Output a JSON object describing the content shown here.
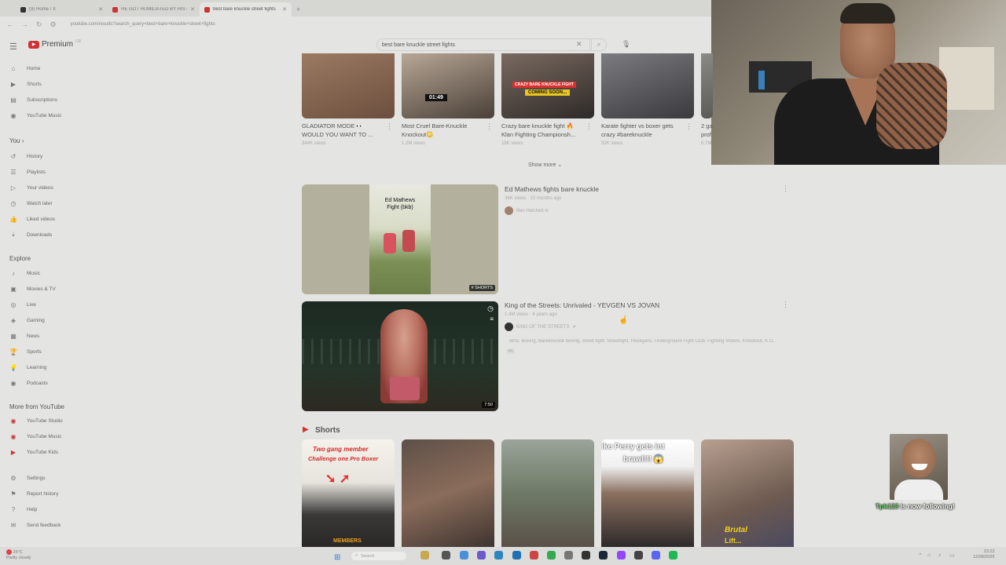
{
  "browser": {
    "tabs": [
      {
        "title": "(9) Home / X",
        "favicon": "x-icon",
        "active": false
      },
      {
        "title": "HE GOT HUMILIATED BY HIS G...",
        "favicon": "youtube-icon",
        "active": false
      },
      {
        "title": "best bare knuckle street fights",
        "favicon": "youtube-icon",
        "active": true
      }
    ],
    "new_tab": "+",
    "url": "youtube.com/results?search_query=best+bare+knuckle+street+fights"
  },
  "header": {
    "logo_text": "Premium",
    "logo_country": "GB",
    "search_value": "best bare knuckle street fights"
  },
  "sidebar": {
    "main": [
      {
        "label": "Home",
        "icon": "home-icon"
      },
      {
        "label": "Shorts",
        "icon": "shorts-icon"
      },
      {
        "label": "Subscriptions",
        "icon": "subscriptions-icon"
      },
      {
        "label": "YouTube Music",
        "icon": "music-icon"
      }
    ],
    "you_heading": "You",
    "you": [
      {
        "label": "History",
        "icon": "history-icon"
      },
      {
        "label": "Playlists",
        "icon": "playlist-icon"
      },
      {
        "label": "Your videos",
        "icon": "your-videos-icon"
      },
      {
        "label": "Watch later",
        "icon": "watch-later-icon"
      },
      {
        "label": "Liked videos",
        "icon": "like-icon"
      },
      {
        "label": "Downloads",
        "icon": "download-icon"
      }
    ],
    "explore_heading": "Explore",
    "explore": [
      {
        "label": "Music",
        "icon": "music-note-icon"
      },
      {
        "label": "Movies & TV",
        "icon": "movies-icon"
      },
      {
        "label": "Live",
        "icon": "live-icon"
      },
      {
        "label": "Gaming",
        "icon": "gaming-icon"
      },
      {
        "label": "News",
        "icon": "news-icon"
      },
      {
        "label": "Sports",
        "icon": "sports-icon"
      },
      {
        "label": "Learning",
        "icon": "learning-icon"
      },
      {
        "label": "Podcasts",
        "icon": "podcast-icon"
      }
    ],
    "more_heading": "More from YouTube",
    "more": [
      {
        "label": "YouTube Studio",
        "icon": "studio-icon"
      },
      {
        "label": "YouTube Music",
        "icon": "yt-music-icon"
      },
      {
        "label": "YouTube Kids",
        "icon": "yt-kids-icon"
      }
    ],
    "footer": [
      {
        "label": "Settings",
        "icon": "settings-icon"
      },
      {
        "label": "Report history",
        "icon": "flag-icon"
      },
      {
        "label": "Help",
        "icon": "help-icon"
      },
      {
        "label": "Send feedback",
        "icon": "feedback-icon"
      }
    ]
  },
  "top_row": [
    {
      "title_line1": "GLADIATOR MODE 👀",
      "title_line2": "WOULD YOU WANT TO ...",
      "views": "344K views"
    },
    {
      "title_line1": "Most Cruel Bare-Knuckle",
      "title_line2": "Knockout😳",
      "views": "1.2M views",
      "thumb_time": "01:49"
    },
    {
      "title_line1": "Crazy bare knuckle fight 🔥",
      "title_line2": "Klan Fighting Championsh...",
      "views": "18K views",
      "thumb_caption1": "CRAZY BARE KNUCKLE FIGHT",
      "thumb_caption2": "COMING SOON..."
    },
    {
      "title_line1": "Karate fighter vs boxer gets",
      "title_line2": "crazy #bareknuckle",
      "views": "92K views"
    },
    {
      "title_line1": "2 ga",
      "title_line2": "prof",
      "views": "6.7M"
    }
  ],
  "show_more": "Show more",
  "results": [
    {
      "title": "Ed Mathews fights bare knuckle",
      "meta": "36K views · 10 months ago",
      "channel": "Ben Hatchett tv",
      "badge": "SHORTS",
      "thumb_text_1": "Ed Mathews",
      "thumb_text_2": "Fight (bkb)"
    },
    {
      "title": "King of the Streets: Unrivaled - YEVGEN VS JOVAN",
      "meta": "1.4M views · 4 years ago",
      "channel": "KING OF THE STREETS",
      "snippet": "BKB, Boxing, Bareknuckle boxing, street fight, Streetfight, Hooligans, Underground Fight Club, Fighting Videos, Knockout, K.O...",
      "quality": "4K",
      "duration": "7:50"
    }
  ],
  "shorts": {
    "heading": "Shorts",
    "items": [
      {
        "caption1": "Two gang member",
        "caption2": "Challenge one Pro Boxer",
        "caption3": "MEMBERS"
      },
      {
        "caption1": ""
      },
      {
        "caption1": ""
      },
      {
        "caption1": "ike Perry gets int",
        "caption2": "brawl!!! 😱"
      },
      {
        "caption1": "Brutal",
        "caption2": "Lift..."
      }
    ]
  },
  "follow_alert": {
    "name": "Tpk123",
    "text": "is now following!"
  },
  "taskbar": {
    "weather_temp": "25°C",
    "weather_desc": "Partly cloudy",
    "search_placeholder": "Search",
    "time": "23:22",
    "date": "12/08/2025"
  }
}
